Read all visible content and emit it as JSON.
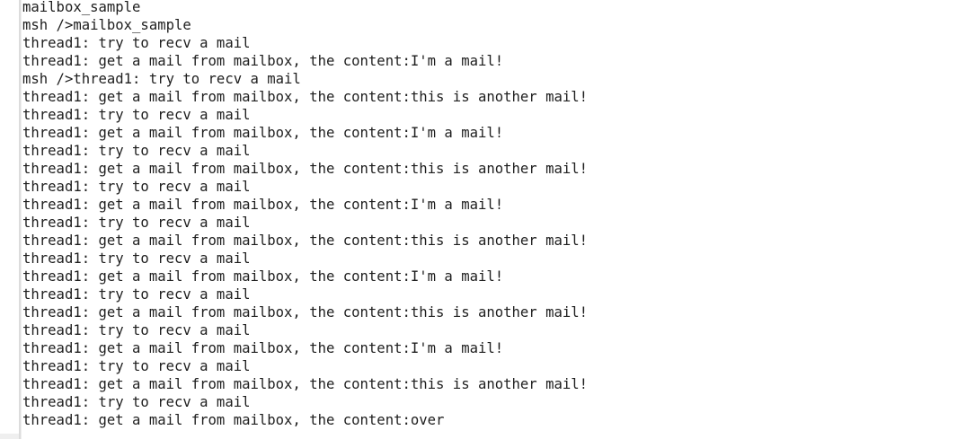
{
  "console": {
    "lines": [
      "mailbox_sample",
      "msh />mailbox_sample",
      "thread1: try to recv a mail",
      "thread1: get a mail from mailbox, the content:I'm a mail!",
      "msh />thread1: try to recv a mail",
      "thread1: get a mail from mailbox, the content:this is another mail!",
      "thread1: try to recv a mail",
      "thread1: get a mail from mailbox, the content:I'm a mail!",
      "thread1: try to recv a mail",
      "thread1: get a mail from mailbox, the content:this is another mail!",
      "thread1: try to recv a mail",
      "thread1: get a mail from mailbox, the content:I'm a mail!",
      "thread1: try to recv a mail",
      "thread1: get a mail from mailbox, the content:this is another mail!",
      "thread1: try to recv a mail",
      "thread1: get a mail from mailbox, the content:I'm a mail!",
      "thread1: try to recv a mail",
      "thread1: get a mail from mailbox, the content:this is another mail!",
      "thread1: try to recv a mail",
      "thread1: get a mail from mailbox, the content:I'm a mail!",
      "thread1: try to recv a mail",
      "thread1: get a mail from mailbox, the content:this is another mail!",
      "thread1: try to recv a mail",
      "thread1: get a mail from mailbox, the content:over"
    ]
  },
  "colors": {
    "background": "#ffffff",
    "text": "#1e1e1e",
    "gutter": "#dcdcdc"
  }
}
